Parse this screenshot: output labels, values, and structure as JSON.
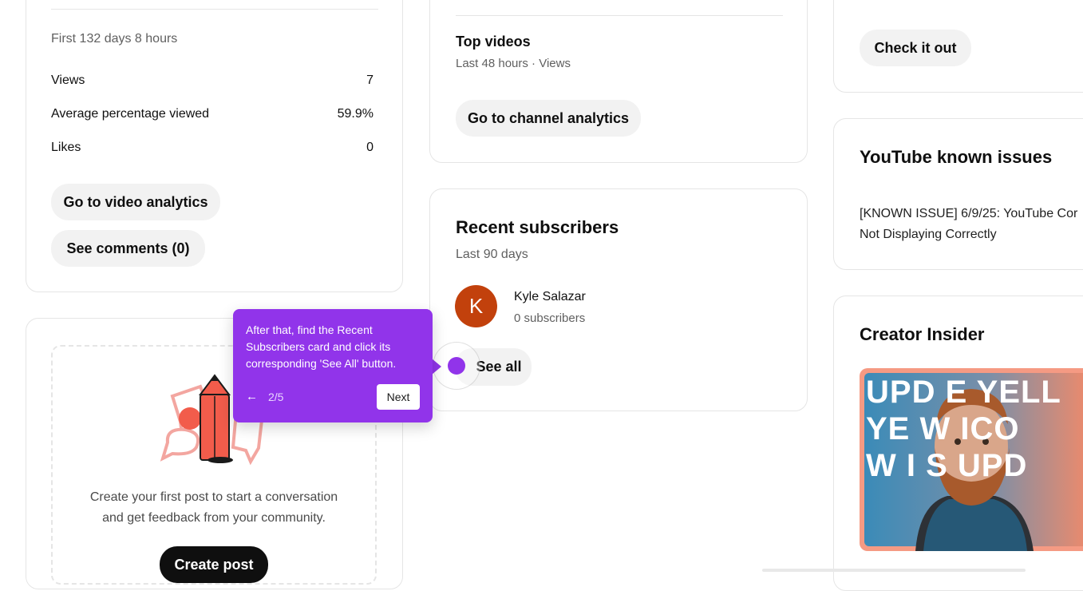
{
  "video_card": {
    "period": "First 132 days 8 hours",
    "stats": [
      {
        "label": "Views",
        "value": "7"
      },
      {
        "label": "Average percentage viewed",
        "value": "59.9%"
      },
      {
        "label": "Likes",
        "value": "0"
      }
    ],
    "analytics_button": "Go to video analytics",
    "comments_button": "See comments (0)"
  },
  "post_card": {
    "message_line1": "Create your first post to start a conversation",
    "message_line2": "and get feedback from your community.",
    "create_button": "Create post"
  },
  "channel_card": {
    "top_videos_title": "Top videos",
    "top_videos_subtitle": "Last 48 hours · Views",
    "channel_analytics_button": "Go to channel analytics"
  },
  "subscribers_card": {
    "title": "Recent subscribers",
    "subtitle": "Last 90 days",
    "subscriber": {
      "initial": "K",
      "name": "Kyle Salazar",
      "subs": "0 subscribers"
    },
    "see_all_button": "See all"
  },
  "right_column": {
    "check_button": "Check it out",
    "known_issues_title": "YouTube known issues",
    "known_issue_line1": "[KNOWN ISSUE] 6/9/25: YouTube Cor",
    "known_issue_line2": "Not Displaying Correctly",
    "insider_title": "Creator Insider",
    "thumbnail_text_1": "UPD  E YELL",
    "thumbnail_text_2": "YE    W ICO",
    "thumbnail_text_3": "W I   S UPD"
  },
  "tooltip": {
    "text": "After that, find the Recent Subscribers card and click its corresponding 'See All' button.",
    "back_icon": "←",
    "step": "2/5",
    "next_label": "Next"
  },
  "colors": {
    "tooltip_purple": "#9134ea",
    "avatar_orange": "#c2410c",
    "pill_gray": "#f2f2f2"
  }
}
